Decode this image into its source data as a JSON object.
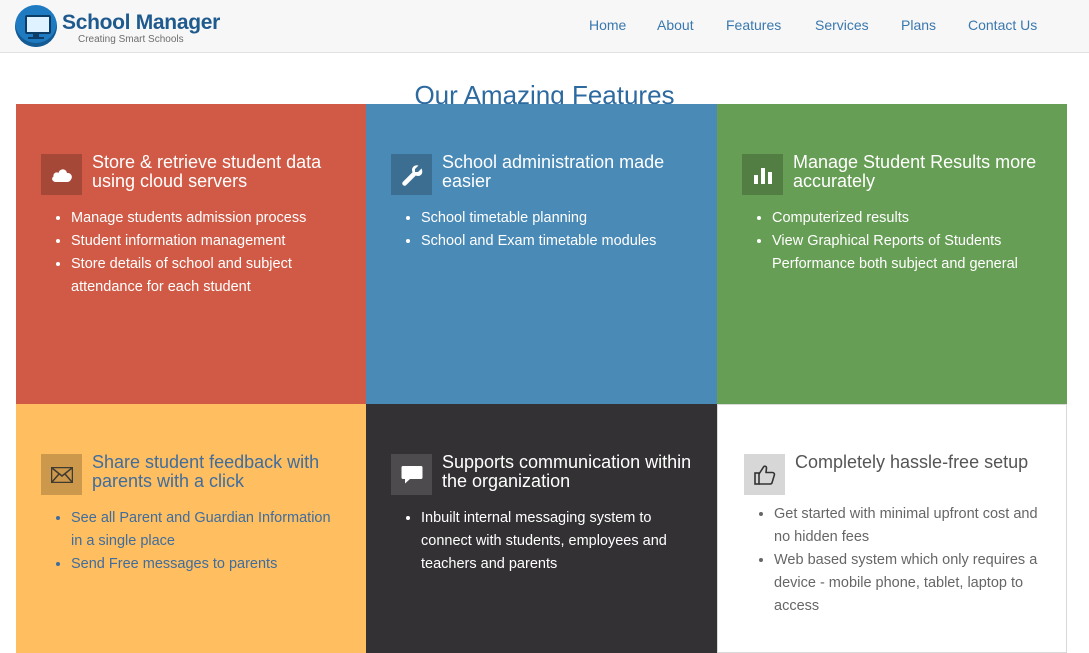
{
  "app": {
    "brand": "School Manager",
    "tagline": "Creating Smart Schools"
  },
  "nav": {
    "items": [
      {
        "label": "Home"
      },
      {
        "label": "About"
      },
      {
        "label": "Features"
      },
      {
        "label": "Services"
      },
      {
        "label": "Plans"
      },
      {
        "label": "Contact Us"
      }
    ]
  },
  "page": {
    "title": "Our Amazing Features"
  },
  "features": [
    {
      "icon": "cloud-icon",
      "color": "#d05a46",
      "title": "Store & retrieve student data using cloud servers",
      "points": [
        "Manage students admission process",
        "Student information management",
        "Store details of school and subject attendance for each student"
      ]
    },
    {
      "icon": "wrench-icon",
      "color": "#4a8ab6",
      "title": "School administration made easier",
      "points": [
        "School timetable planning",
        "School and Exam timetable modules"
      ]
    },
    {
      "icon": "bar-chart-icon",
      "color": "#679e55",
      "title": "Manage Student Results more accurately",
      "points": [
        "Computerized results",
        "View Graphical Reports of Students Performance both subject and general"
      ]
    },
    {
      "icon": "envelope-icon",
      "color": "#ffbe5f",
      "title": "Share student feedback with parents with a click",
      "points": [
        "See all Parent and Guardian Information in a single place",
        "Send Free messages to parents"
      ]
    },
    {
      "icon": "chat-bubble-icon",
      "color": "#333133",
      "title": "Supports communication within the organization",
      "points": [
        "Inbuilt internal messaging system to connect with students, employees and teachers and parents"
      ]
    },
    {
      "icon": "thumbs-up-icon",
      "color": "#ffffff",
      "title": "Completely hassle-free setup",
      "points": [
        "Get started with minimal upfront cost and no hidden fees",
        "Web based system which only requires a device - mobile phone, tablet, laptop to access"
      ]
    }
  ]
}
